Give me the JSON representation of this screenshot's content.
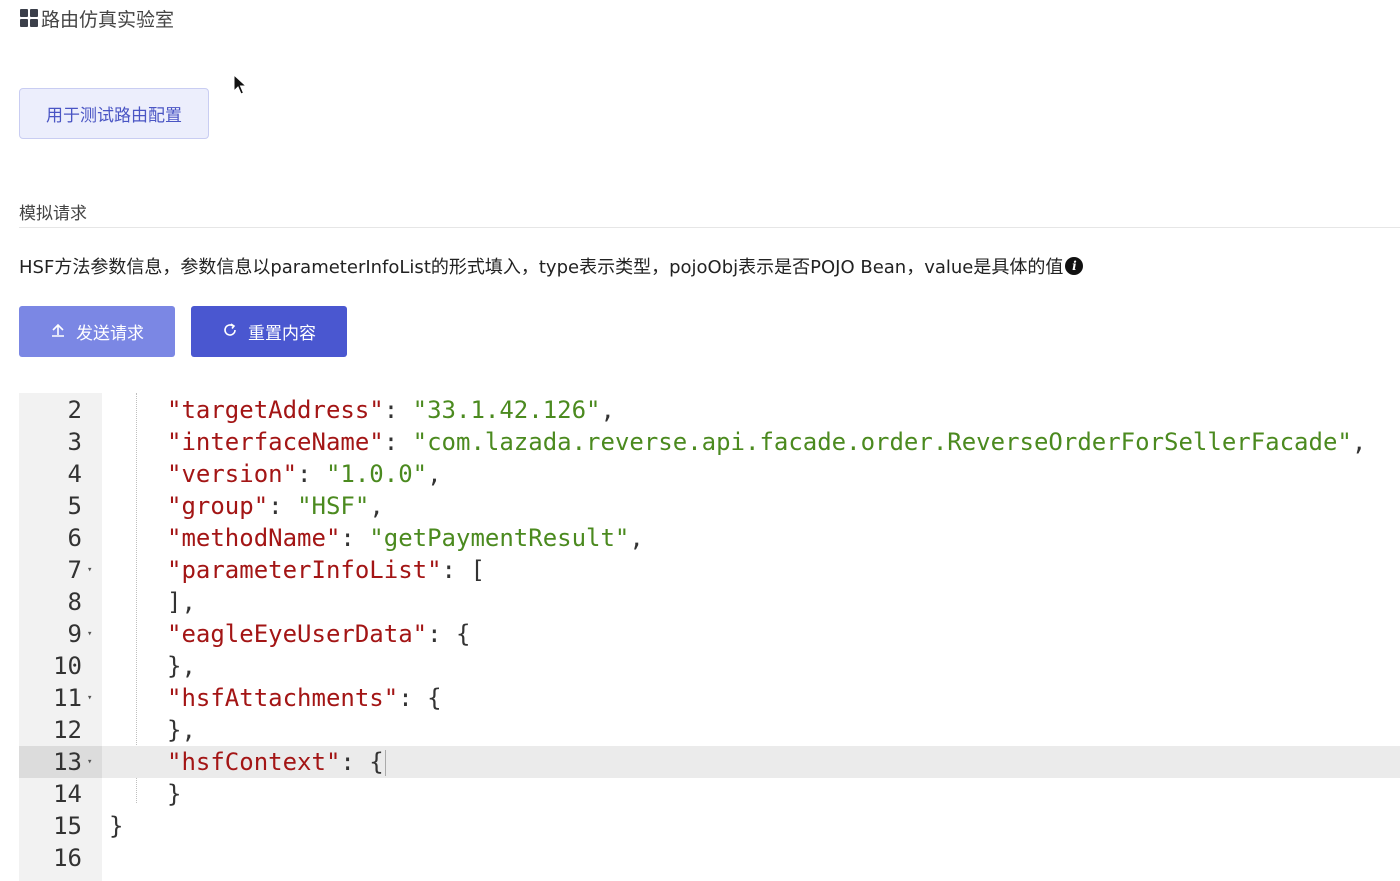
{
  "page": {
    "title": "路由仿真实验室",
    "tag_label": "用于测试路由配置",
    "section_title": "模拟请求",
    "description": "HSF方法参数信息，参数信息以parameterInfoList的形式填入，type表示类型，pojoObj表示是否POJO Bean，value是具体的值"
  },
  "toolbar": {
    "send_label": "发送请求",
    "reset_label": "重置内容"
  },
  "icons": {
    "title_icon": "grid-icon",
    "info_icon": "info-icon",
    "send_icon": "upload-icon",
    "reset_icon": "refresh-icon"
  },
  "colors": {
    "primary": "#4a57d0",
    "primary_light": "#7b87e4",
    "json_key": "#a31515",
    "json_string": "#4b8a1f"
  },
  "editor": {
    "active_line": 13,
    "lines": [
      {
        "n": "2",
        "fold": "",
        "tokens": [
          {
            "t": "key",
            "v": "\"targetAddress\""
          },
          {
            "t": "p",
            "v": ": "
          },
          {
            "t": "str",
            "v": "\"33.1.42.126\""
          },
          {
            "t": "p",
            "v": ","
          }
        ]
      },
      {
        "n": "3",
        "fold": "",
        "tokens": [
          {
            "t": "key",
            "v": "\"interfaceName\""
          },
          {
            "t": "p",
            "v": ": "
          },
          {
            "t": "str",
            "v": "\"com.lazada.reverse.api.facade.order.ReverseOrderForSellerFacade\""
          },
          {
            "t": "p",
            "v": ","
          }
        ]
      },
      {
        "n": "4",
        "fold": "",
        "tokens": [
          {
            "t": "key",
            "v": "\"version\""
          },
          {
            "t": "p",
            "v": ": "
          },
          {
            "t": "str",
            "v": "\"1.0.0\""
          },
          {
            "t": "p",
            "v": ","
          }
        ]
      },
      {
        "n": "5",
        "fold": "",
        "tokens": [
          {
            "t": "key",
            "v": "\"group\""
          },
          {
            "t": "p",
            "v": ": "
          },
          {
            "t": "str",
            "v": "\"HSF\""
          },
          {
            "t": "p",
            "v": ","
          }
        ]
      },
      {
        "n": "6",
        "fold": "",
        "tokens": [
          {
            "t": "key",
            "v": "\"methodName\""
          },
          {
            "t": "p",
            "v": ": "
          },
          {
            "t": "str",
            "v": "\"getPaymentResult\""
          },
          {
            "t": "p",
            "v": ","
          }
        ]
      },
      {
        "n": "7",
        "fold": "▾",
        "tokens": [
          {
            "t": "key",
            "v": "\"parameterInfoList\""
          },
          {
            "t": "p",
            "v": ": ["
          }
        ]
      },
      {
        "n": "8",
        "fold": "",
        "tokens": [
          {
            "t": "p",
            "v": "],"
          }
        ]
      },
      {
        "n": "9",
        "fold": "▾",
        "tokens": [
          {
            "t": "key",
            "v": "\"eagleEyeUserData\""
          },
          {
            "t": "p",
            "v": ": {"
          }
        ]
      },
      {
        "n": "10",
        "fold": "",
        "tokens": [
          {
            "t": "p",
            "v": "},"
          }
        ]
      },
      {
        "n": "11",
        "fold": "▾",
        "tokens": [
          {
            "t": "key",
            "v": "\"hsfAttachments\""
          },
          {
            "t": "p",
            "v": ": {"
          }
        ]
      },
      {
        "n": "12",
        "fold": "",
        "tokens": [
          {
            "t": "p",
            "v": "},"
          }
        ]
      },
      {
        "n": "13",
        "fold": "▾",
        "tokens": [
          {
            "t": "key",
            "v": "\"hsfContext\""
          },
          {
            "t": "p",
            "v": ": {"
          }
        ]
      },
      {
        "n": "14",
        "fold": "",
        "tokens": [
          {
            "t": "p",
            "v": "}"
          }
        ]
      },
      {
        "n": "15",
        "fold": "",
        "tokens": [
          {
            "t": "p",
            "v": "}"
          }
        ]
      },
      {
        "n": "16",
        "fold": "",
        "tokens": []
      }
    ]
  }
}
